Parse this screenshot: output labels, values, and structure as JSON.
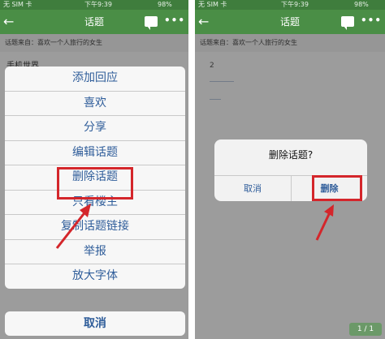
{
  "status": {
    "carrier": "无 SIM 卡",
    "time": "下午9:39",
    "battery": "98%"
  },
  "nav": {
    "back": "←",
    "title": "话题",
    "more": "•••"
  },
  "subbar": {
    "text": "话题来自：喜欢一个人旅行的女生"
  },
  "left": {
    "topic_title": "手机世界",
    "menu_items": [
      "添加回应",
      "喜欢",
      "分享",
      "编辑话题",
      "删除话题",
      "只看楼主",
      "复制话题链接",
      "举报",
      "放大字体"
    ],
    "cancel": "取消"
  },
  "right": {
    "page_mark": "2",
    "dialog": {
      "title": "删除话题?",
      "cancel": "取消",
      "confirm": "删除"
    },
    "pager": "1 / 1"
  },
  "colors": {
    "nav_green": "#4a8e46",
    "ios_blue": "#2f5d9a",
    "highlight_red": "#d4262b"
  }
}
